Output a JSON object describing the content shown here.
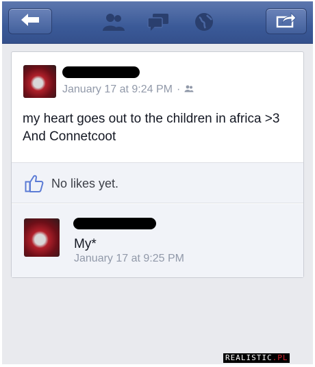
{
  "topbar": {
    "back_icon": "back-arrow-icon",
    "friends_icon": "friends-icon",
    "messages_icon": "messages-icon",
    "globe_icon": "notifications-globe-icon",
    "share_icon": "share-icon"
  },
  "post": {
    "timestamp": "January 17 at 9:24 PM",
    "separator": "·",
    "privacy_icon": "friends-audience-icon",
    "text": "my heart goes out to the children in africa >3 And Connetcoot"
  },
  "likes": {
    "icon": "thumbs-up-icon",
    "label": "No likes yet."
  },
  "comment": {
    "text": "My*",
    "timestamp": "January 17 at 9:25 PM"
  },
  "watermark": {
    "text_main": "REALISTIC",
    "text_accent": ".PL"
  },
  "colors": {
    "topbar": "#3b5a98",
    "card_bg": "#ffffff",
    "meta_text": "#9199a9",
    "background": "#e9eaee"
  }
}
